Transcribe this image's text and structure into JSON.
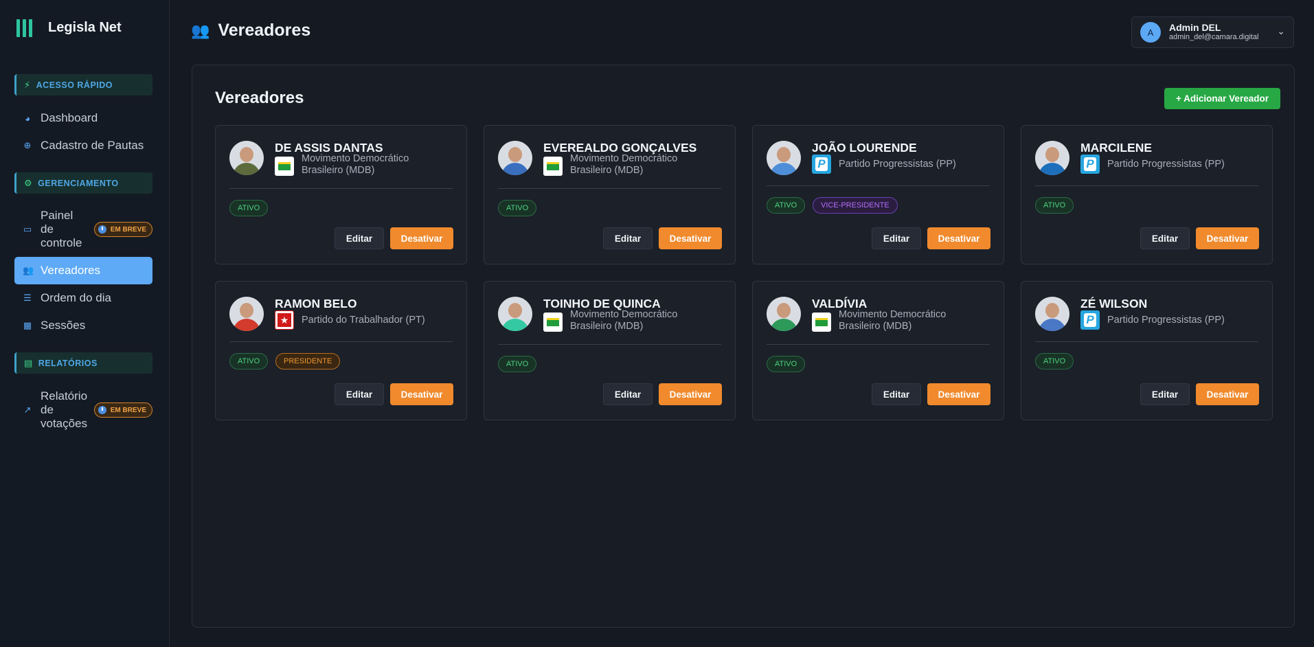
{
  "app": {
    "name": "Legisla Net"
  },
  "sidebar": {
    "sections": [
      {
        "label": "ACESSO RÁPIDO",
        "icon": "bolt-icon"
      },
      {
        "label": "GERENCIAMENTO",
        "icon": "gears-icon"
      },
      {
        "label": "RELATÓRIOS",
        "icon": "chart-icon"
      }
    ],
    "items": {
      "dashboard": "Dashboard",
      "cadastro": "Cadastro de Pautas",
      "painel": "Painel de controle",
      "vereadores": "Vereadores",
      "ordem": "Ordem do dia",
      "sessoes": "Sessões",
      "relatorio": "Relatório de votações"
    },
    "soon_badge": "EM BREVE"
  },
  "header": {
    "title": "Vereadores"
  },
  "user": {
    "initial": "A",
    "name": "Admin DEL",
    "email": "admin_del@camara.digital"
  },
  "main": {
    "title": "Vereadores",
    "add_label": "+ Adicionar Vereador",
    "edit_label": "Editar",
    "deactivate_label": "Desativar",
    "cards": [
      {
        "name": "DE ASSIS DANTAS",
        "party": "Movimento Democrático Brasileiro (MDB)",
        "party_logo": "mdb",
        "status": "ATIVO",
        "role": ""
      },
      {
        "name": "EVEREALDO GONÇALVES",
        "party": "Movimento Democrático Brasileiro (MDB)",
        "party_logo": "mdb",
        "status": "ATIVO",
        "role": ""
      },
      {
        "name": "JOÃO LOURENDE",
        "party": "Partido Progressistas (PP)",
        "party_logo": "pp",
        "status": "ATIVO",
        "role": "VICE-PRESIDENTE"
      },
      {
        "name": "MARCILENE",
        "party": "Partido Progressistas (PP)",
        "party_logo": "pp",
        "status": "ATIVO",
        "role": ""
      },
      {
        "name": "RAMON BELO",
        "party": "Partido do Trabalhador (PT)",
        "party_logo": "pt",
        "status": "ATIVO",
        "role": "PRESIDENTE"
      },
      {
        "name": "TOINHO DE QUINCA",
        "party": "Movimento Democrático Brasileiro (MDB)",
        "party_logo": "mdb",
        "status": "ATIVO",
        "role": ""
      },
      {
        "name": "VALDÍVIA",
        "party": "Movimento Democrático Brasileiro (MDB)",
        "party_logo": "mdb",
        "status": "ATIVO",
        "role": ""
      },
      {
        "name": "ZÉ WILSON",
        "party": "Partido Progressistas (PP)",
        "party_logo": "pp",
        "status": "ATIVO",
        "role": ""
      }
    ]
  },
  "colors": {
    "accent": "#5eaaf7",
    "success": "#27a844",
    "warning": "#f08a2d"
  }
}
